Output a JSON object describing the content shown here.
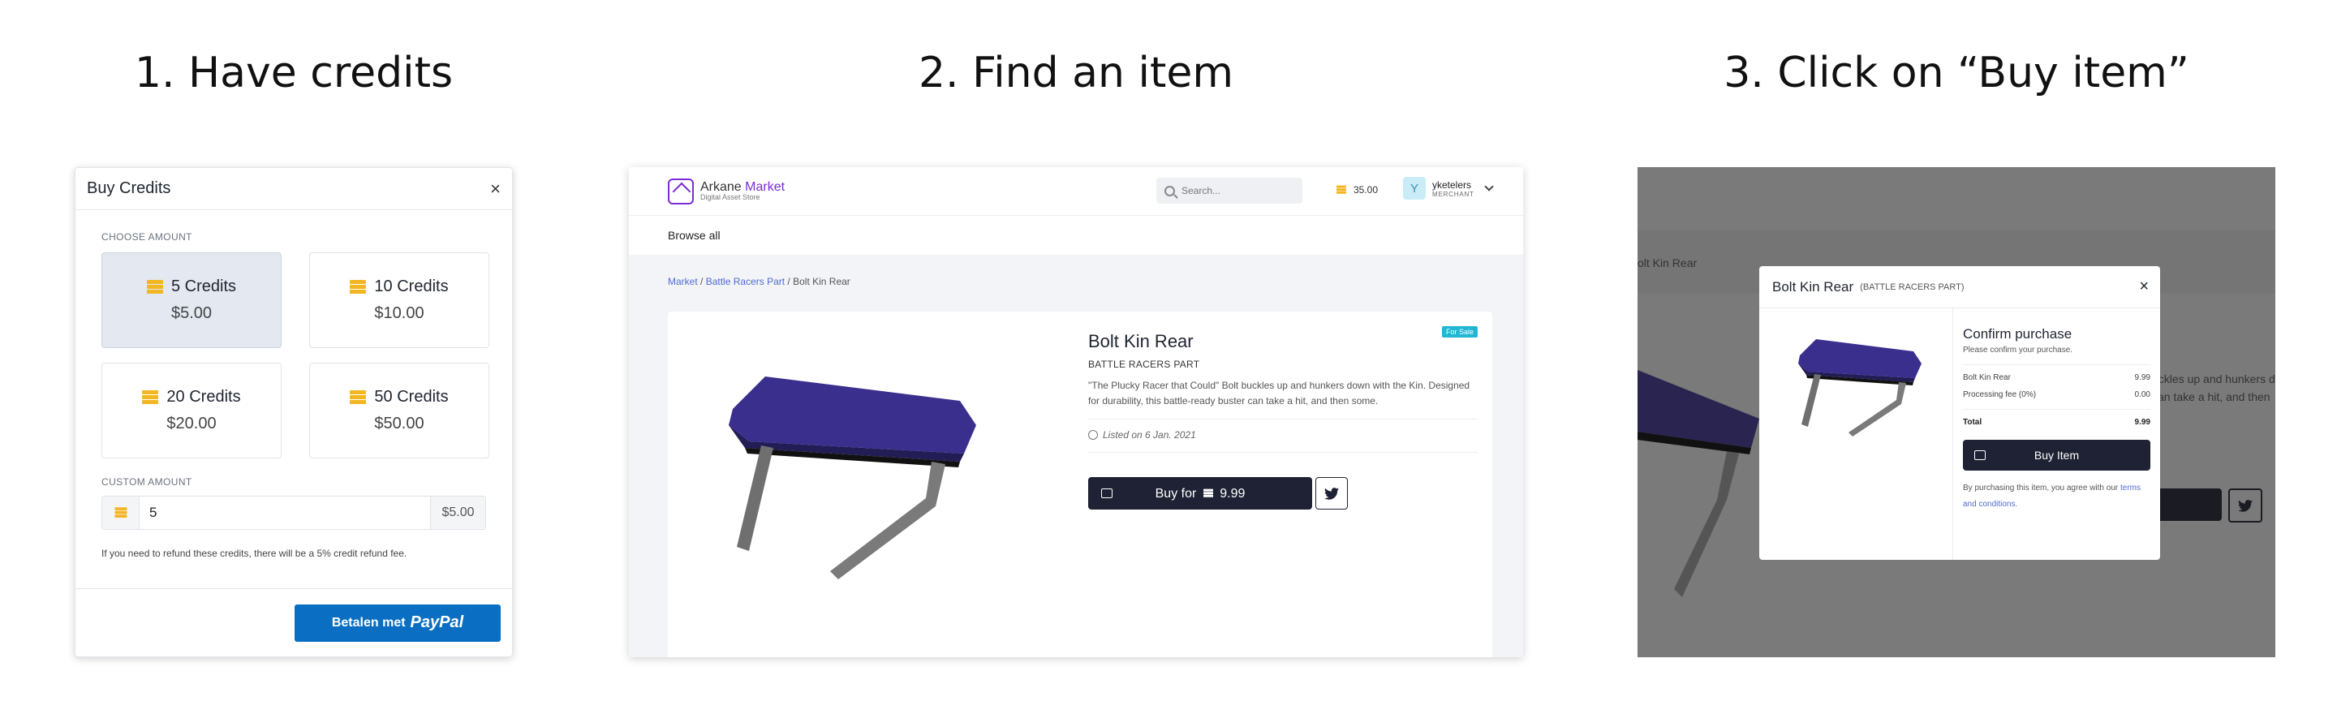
{
  "steps": [
    {
      "title": "1. Have credits"
    },
    {
      "title": "2. Find an item"
    },
    {
      "title": "3. Click on “Buy item”"
    }
  ],
  "buy_credits": {
    "title": "Buy Credits",
    "close": "×",
    "choose_label": "CHOOSE AMOUNT",
    "options": [
      {
        "label": "5 Credits",
        "price": "$5.00",
        "selected": true
      },
      {
        "label": "10 Credits",
        "price": "$10.00",
        "selected": false
      },
      {
        "label": "20 Credits",
        "price": "$20.00",
        "selected": false
      },
      {
        "label": "50 Credits",
        "price": "$50.00",
        "selected": false
      }
    ],
    "custom_label": "CUSTOM AMOUNT",
    "custom_value": "5",
    "custom_price": "$5.00",
    "refund_note": "If you need to refund these credits, there will be a 5% credit refund fee.",
    "paypal_prefix": "Betalen met",
    "paypal_brand": "PayPal"
  },
  "market": {
    "logo_name_a": "Arkane ",
    "logo_name_b": "Market",
    "logo_sub": "Digital Asset Store",
    "search_placeholder": "Search...",
    "balance": "35.00",
    "user_initial": "Y",
    "username": "yketelers",
    "user_role": "MERCHANT",
    "subnav": "Browse all",
    "breadcrumb": [
      "Market",
      "Battle Racers Part",
      "Bolt Kin Rear"
    ],
    "badge": "For Sale",
    "item_name": "Bolt Kin Rear",
    "item_category": "BATTLE RACERS PART",
    "item_description": "\"The Plucky Racer that Could\" Bolt buckles up and hunkers down with the Kin. Designed for durability, this battle-ready buster can take a hit, and then some.",
    "listed": "Listed on 6 Jan. 2021",
    "buy_prefix": "Buy for",
    "buy_price": "9.99"
  },
  "confirm": {
    "bg_crumb": "olt Kin Rear",
    "bg_desc_1": "uckles up and hunkers d",
    "bg_desc_2": "can take a hit, and then",
    "title": "Bolt Kin Rear",
    "category": "(BATTLE RACERS PART)",
    "close": "×",
    "heading": "Confirm purchase",
    "subheading": "Please confirm your purchase.",
    "rows": [
      {
        "label": "Bolt Kin Rear",
        "value": "9.99"
      },
      {
        "label": "Processing fee (0%)",
        "value": "0.00"
      }
    ],
    "total_label": "Total",
    "total_value": "9.99",
    "button": "Buy Item",
    "note_prefix": "By purchasing this item, you agree with our ",
    "note_link": "terms and conditions",
    "note_suffix": "."
  },
  "colors": {
    "accent": "#1f2234",
    "paypal": "#0a6fc2",
    "brand": "#7b2bd4",
    "coin": "#f3b623"
  }
}
